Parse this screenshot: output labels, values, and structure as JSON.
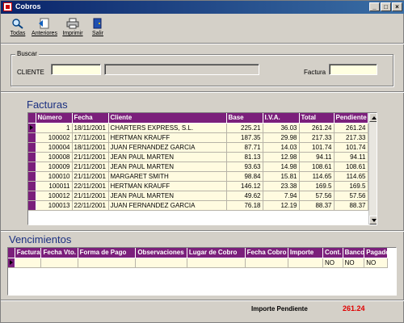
{
  "window": {
    "title": "Cobros"
  },
  "toolbar": {
    "buttons": [
      {
        "label": "Todas",
        "icon": "search-all-icon"
      },
      {
        "label": "Anteriores",
        "icon": "previous-icon"
      },
      {
        "label": "Imprimir",
        "icon": "printer-icon"
      },
      {
        "label": "Salir",
        "icon": "exit-door-icon"
      }
    ]
  },
  "search": {
    "legend": "Buscar",
    "cliente_label": "CLIENTE",
    "cliente_code": "",
    "cliente_name": "",
    "factura_label": "Factura",
    "factura_value": ""
  },
  "facturas": {
    "title": "Facturas",
    "columns": [
      "Número",
      "Fecha",
      "Cliente",
      "Base",
      "I.V.A.",
      "Total",
      "Pendiente"
    ],
    "rows": [
      [
        "1",
        "18/11/2001",
        "CHARTERS EXPRESS, S.L.",
        "225.21",
        "36.03",
        "261.24",
        "261.24"
      ],
      [
        "100002",
        "17/11/2001",
        "HERTMAN KRAUFF",
        "187.35",
        "29.98",
        "217.33",
        "217.33"
      ],
      [
        "100004",
        "18/11/2001",
        "JUAN FERNANDEZ GARCIA",
        "87.71",
        "14.03",
        "101.74",
        "101.74"
      ],
      [
        "100008",
        "21/11/2001",
        "JEAN PAUL MARTEN",
        "81.13",
        "12.98",
        "94.11",
        "94.11"
      ],
      [
        "100009",
        "21/11/2001",
        "JEAN PAUL MARTEN",
        "93.63",
        "14.98",
        "108.61",
        "108.61"
      ],
      [
        "100010",
        "21/11/2001",
        "MARGARET SMITH",
        "98.84",
        "15.81",
        "114.65",
        "114.65"
      ],
      [
        "100011",
        "22/11/2001",
        "HERTMAN KRAUFF",
        "146.12",
        "23.38",
        "169.5",
        "169.5"
      ],
      [
        "100012",
        "21/11/2001",
        "JEAN PAUL MARTEN",
        "49.62",
        "7.94",
        "57.56",
        "57.56"
      ],
      [
        "100013",
        "22/11/2001",
        "JUAN FERNANDEZ GARCIA",
        "76.18",
        "12.19",
        "88.37",
        "88.37"
      ]
    ]
  },
  "vencimientos": {
    "title": "Vencimientos",
    "columns": [
      "Factura",
      "Fecha Vto.",
      "Forma de Pago",
      "Observaciones",
      "Lugar de Cobro",
      "Fecha Cobro",
      "Importe",
      "Cont.",
      "Banco",
      "Pagado"
    ],
    "rows": [
      [
        "",
        "",
        "",
        "",
        "",
        "",
        "",
        "NO",
        "NO",
        "NO"
      ]
    ]
  },
  "footer": {
    "importe_label": "Importe Pendiente",
    "importe_value": "261.24"
  },
  "colors": {
    "header": "#7b1f7b",
    "title_blue": "#1a2f80",
    "row_bg": "#fffbe0",
    "amount_red": "#e00000"
  }
}
